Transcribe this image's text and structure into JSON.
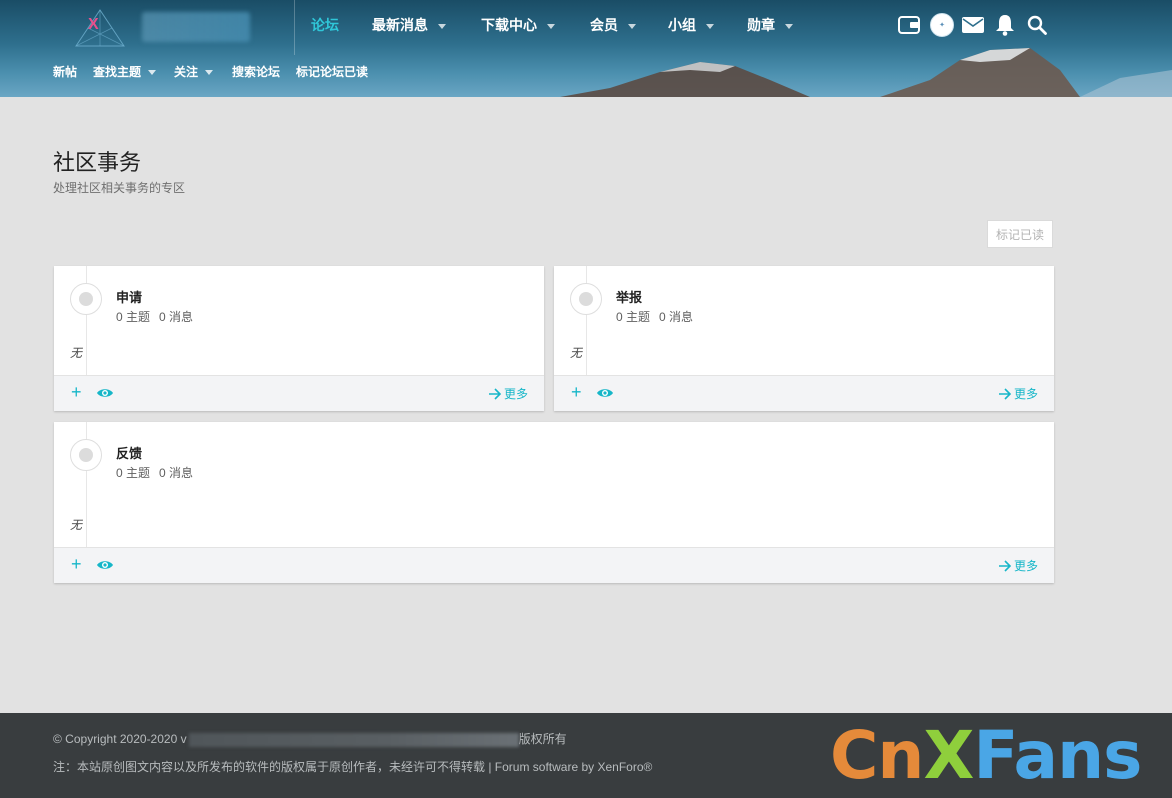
{
  "header": {
    "logo_letter": "X",
    "nav": [
      {
        "label": "论坛",
        "active": true,
        "dropdown": false
      },
      {
        "label": "最新消息",
        "active": false,
        "dropdown": true
      },
      {
        "label": "下载中心",
        "active": false,
        "dropdown": true
      },
      {
        "label": "会员",
        "active": false,
        "dropdown": true
      },
      {
        "label": "小组",
        "active": false,
        "dropdown": true
      },
      {
        "label": "勋章",
        "active": false,
        "dropdown": true
      }
    ],
    "subnav": [
      {
        "label": "新帖",
        "dropdown": false
      },
      {
        "label": "查找主题",
        "dropdown": true
      },
      {
        "label": "关注",
        "dropdown": true
      },
      {
        "label": "搜索论坛",
        "dropdown": false
      },
      {
        "label": "标记论坛已读",
        "dropdown": false
      }
    ],
    "icons": [
      "wallet-icon",
      "avatar",
      "mail-icon",
      "bell-icon",
      "search-icon"
    ],
    "accent_color": "#2fc6d8"
  },
  "page": {
    "title": "社区事务",
    "description": "处理社区相关事务的专区",
    "mark_read_label": "标记已读"
  },
  "forums": [
    {
      "title": "申请",
      "threads": "0 主题",
      "messages": "0 消息",
      "empty_text": "无",
      "more_label": "更多"
    },
    {
      "title": "举报",
      "threads": "0 主题",
      "messages": "0 消息",
      "empty_text": "无",
      "more_label": "更多"
    },
    {
      "title": "反馈",
      "threads": "0 主题",
      "messages": "0 消息",
      "empty_text": "无",
      "more_label": "更多"
    }
  ],
  "footer": {
    "copyright_prefix": "© Copyright 2020-2020 v",
    "copyright_suffix": "版权所有",
    "notice": "注：本站原创图文内容以及所发布的软件的版权属于原创作者，未经许可不得转载 | Forum software by XenForo®"
  },
  "watermark": {
    "parts": [
      {
        "text": "Cn",
        "color": "#e58a3a"
      },
      {
        "text": "X",
        "color": "#8fcf3c"
      },
      {
        "text": "Fans",
        "color": "#4aa6e6"
      }
    ]
  }
}
